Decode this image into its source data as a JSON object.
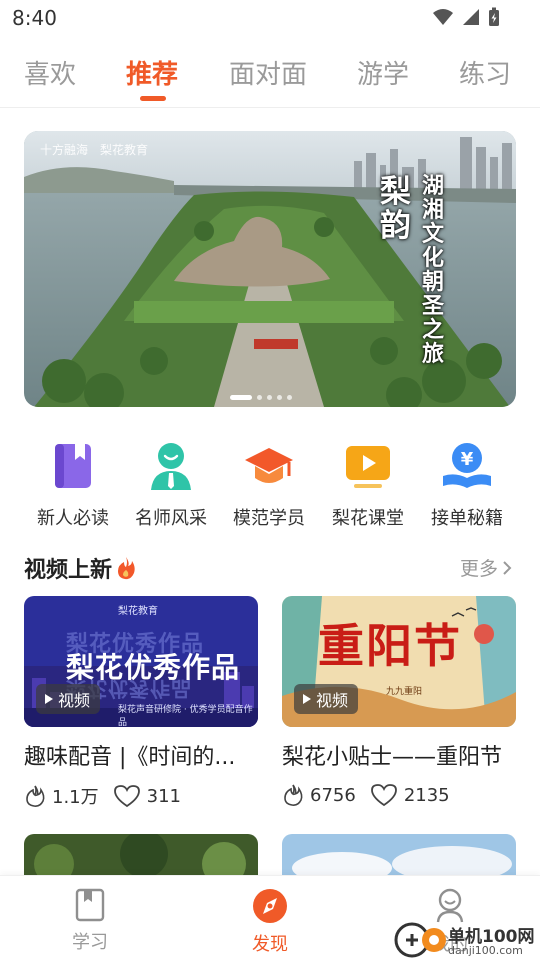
{
  "status_bar": {
    "time": "8:40"
  },
  "top_tabs": [
    {
      "label": "喜欢",
      "active": false
    },
    {
      "label": "推荐",
      "active": true
    },
    {
      "label": "面对面",
      "active": false
    },
    {
      "label": "游学",
      "active": false
    },
    {
      "label": "练习",
      "active": false
    }
  ],
  "banner": {
    "logo_left": "十方融海",
    "logo_right": "梨花教育",
    "title_main": "梨韵",
    "title_sub": "湖湘文化朝圣之旅",
    "dots_total": 5,
    "dots_active": 1
  },
  "quick_links": [
    {
      "label": "新人必读",
      "icon": "book-bookmark-icon",
      "color": "#8a67e8"
    },
    {
      "label": "名师风采",
      "icon": "teacher-avatar-icon",
      "color": "#2fc4a8"
    },
    {
      "label": "模范学员",
      "icon": "graduation-cap-icon",
      "color": "#f2582a"
    },
    {
      "label": "梨花课堂",
      "icon": "video-play-icon",
      "color": "#f6a617"
    },
    {
      "label": "接单秘籍",
      "icon": "yuan-book-icon",
      "color": "#3b8cf5"
    }
  ],
  "section": {
    "title": "视频上新",
    "more": "更多"
  },
  "cards": [
    {
      "title": "趣味配音 |《时间的...",
      "badge": "视频",
      "likes": "1.1万",
      "favorites": "311",
      "thumb_heading": "梨花优秀作品",
      "thumb_logo": "梨花教育",
      "thumb_sub": "梨花声音研修院 · 优秀学员配音作品"
    },
    {
      "title": "梨花小贴士——重阳节",
      "badge": "视频",
      "likes": "6756",
      "favorites": "2135",
      "thumb_heading": "重阳节",
      "thumb_small": "九九重阳"
    }
  ],
  "bottom_nav": [
    {
      "label": "学习",
      "icon": "book-icon",
      "active": false
    },
    {
      "label": "发现",
      "icon": "compass-icon",
      "active": true
    },
    {
      "label": "我的",
      "icon": "user-icon",
      "active": false
    }
  ],
  "watermark": {
    "text": "单机100网",
    "url": "danji100.com"
  },
  "colors": {
    "accent": "#f05a28",
    "muted": "#999999"
  }
}
